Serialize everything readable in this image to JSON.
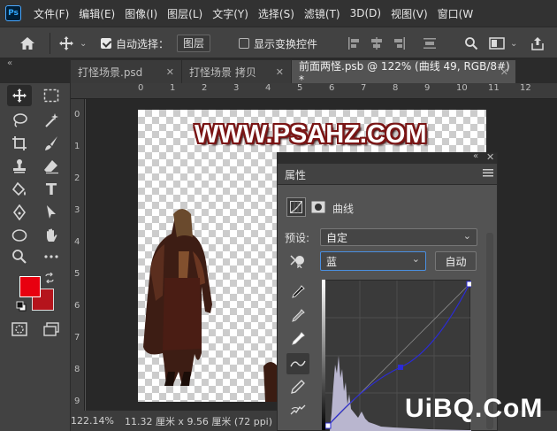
{
  "menubar": {
    "logo": "Ps",
    "items": [
      "文件(F)",
      "编辑(E)",
      "图像(I)",
      "图层(L)",
      "文字(Y)",
      "选择(S)",
      "滤镜(T)",
      "3D(D)",
      "视图(V)",
      "窗口(W"
    ]
  },
  "options": {
    "auto_select_label": "自动选择：",
    "auto_select_target": "图层",
    "show_transform_label": "显示变换控件"
  },
  "tabs": [
    {
      "label": "打怪场景.psd"
    },
    {
      "label": "打怪场景 拷贝"
    },
    {
      "label": "前面两怪.psb @ 122% (曲线 49, RGB/8#) *"
    }
  ],
  "ruler": {
    "top": [
      "0",
      "1",
      "2",
      "3",
      "4",
      "5",
      "6",
      "7",
      "8",
      "9",
      "10",
      "11",
      "12"
    ],
    "left": [
      "0",
      "1",
      "2",
      "3",
      "4",
      "5",
      "6",
      "7",
      "8",
      "9"
    ]
  },
  "canvas": {
    "watermark": "WWW.PSAHZ.COM"
  },
  "status": {
    "zoom": "122.14%",
    "doc_size": "11.32 厘米 x 9.56 厘米 (72 ppi)"
  },
  "properties": {
    "title": "属性",
    "adjustment_name": "曲线",
    "preset_label": "预设:",
    "preset_value": "自定",
    "channel_value": "蓝",
    "auto_button": "自动"
  },
  "brand": "UiBQ.CoM",
  "colors": {
    "foreground": "#e8000f",
    "background": "#b5141c",
    "curve": "#2b2bd6"
  }
}
